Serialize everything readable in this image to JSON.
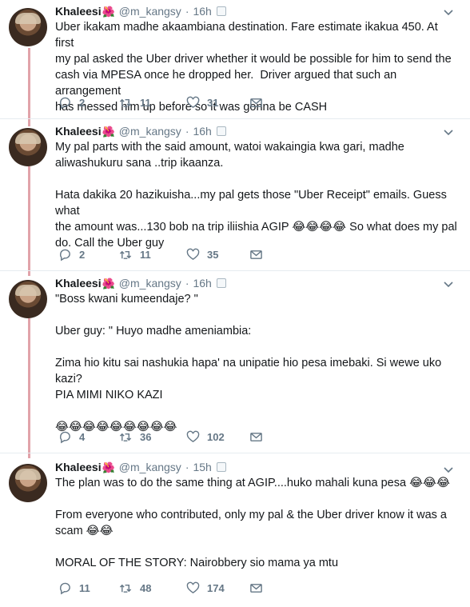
{
  "tweets": [
    {
      "name": "Khaleesi",
      "name_emoji": "🌺",
      "handle": "@m_kangsy",
      "time": "16h",
      "text": "Uber ikakam madhe akaambiana destination. Fare estimate ikakua 450. At first\nmy pal asked the Uber driver whether it would be possible for him to send the\ncash via MPESA once he dropped her.  Driver argued that such an arrangement\nhas messed him up before so it was gonna be CASH",
      "replies": "2",
      "retweets": "11",
      "likes": "31"
    },
    {
      "name": "Khaleesi",
      "name_emoji": "🌺",
      "handle": "@m_kangsy",
      "time": "16h",
      "text": "My pal parts with the said amount, watoi wakaingia kwa gari, madhe\naliwashukuru sana ..trip ikaanza.\n\nHata dakika 20 hazikuisha...my pal gets those \"Uber Receipt\" emails. Guess what\nthe amount was...130 bob na trip iliishia AGIP 😂😂😂😂 So what does my pal\ndo. Call the Uber guy",
      "replies": "2",
      "retweets": "11",
      "likes": "35"
    },
    {
      "name": "Khaleesi",
      "name_emoji": "🌺",
      "handle": "@m_kangsy",
      "time": "16h",
      "text": "\"Boss kwani kumeendaje? \"\n\nUber guy: \" Huyo madhe ameniambia:\n\nZima hio kitu sai nashukia hapa' na unipatie hio pesa imebaki. Si wewe uko kazi?\nPIA MIMI NIKO KAZI\n\n😂😂😂😂😂😂😂😂😂",
      "replies": "4",
      "retweets": "36",
      "likes": "102"
    },
    {
      "name": "Khaleesi",
      "name_emoji": "🌺",
      "handle": "@m_kangsy",
      "time": "15h",
      "text": "The plan was to do the same thing at AGIP....huko mahali kuna pesa 😂😂😂\n\nFrom everyone who contributed, only my pal & the Uber driver know it was a\nscam 😂😂\n\nMORAL OF THE STORY: Nairobbery sio mama ya mtu",
      "replies": "11",
      "retweets": "48",
      "likes": "174"
    }
  ],
  "colors": {
    "thread_line": "#e1a3aa",
    "meta": "#657786",
    "text": "#14171a"
  },
  "icons": [
    "reply-icon",
    "retweet-icon",
    "like-icon",
    "message-icon",
    "chevron-down-icon"
  ]
}
